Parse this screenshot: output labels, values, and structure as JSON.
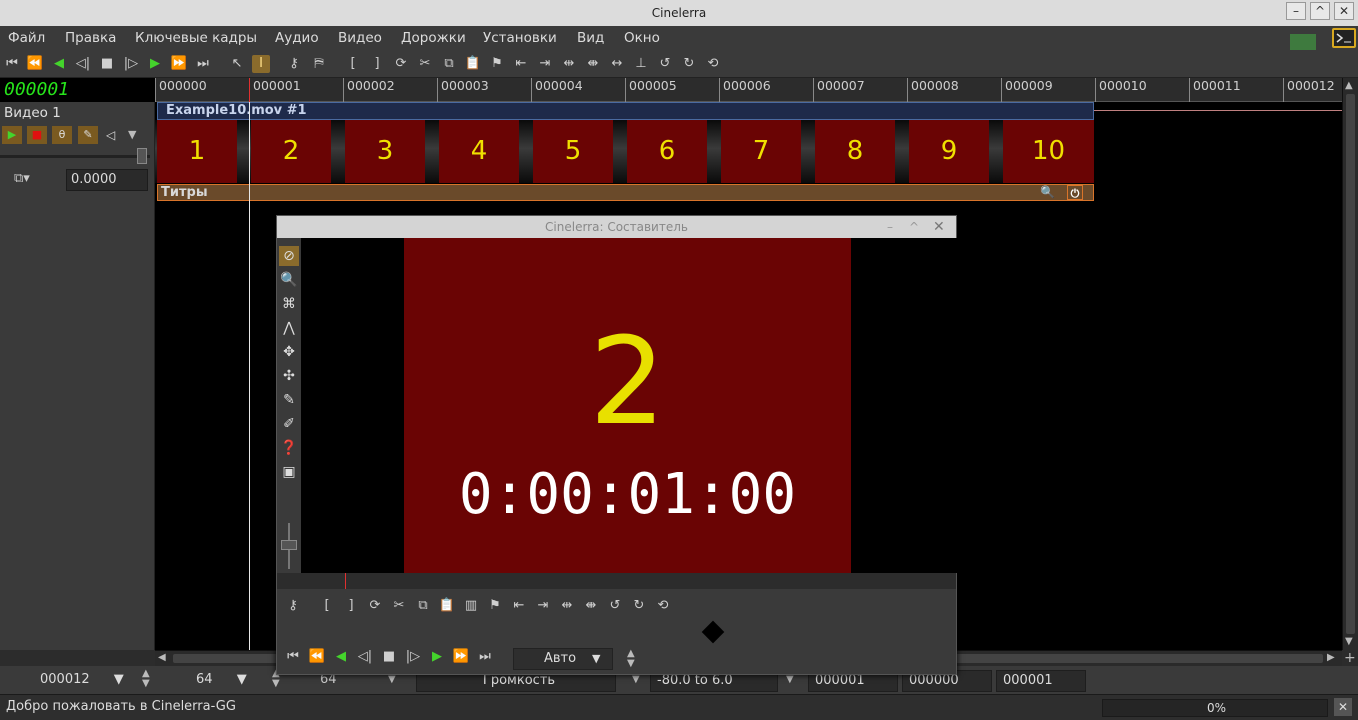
{
  "app": {
    "title": "Cinelerra"
  },
  "menu": [
    "Файл",
    "Правка",
    "Ключевые кадры",
    "Аудио",
    "Видео",
    "Дорожки",
    "Установки",
    "Вид",
    "Окно"
  ],
  "clock": "000001",
  "ruler_labels": [
    "000000",
    "000001",
    "000002",
    "000003",
    "000004",
    "000005",
    "000006",
    "000007",
    "000008",
    "000009",
    "000010",
    "000011",
    "000012"
  ],
  "track": {
    "name": "Видео 1",
    "fade_value": "0.0000",
    "clip_title": "Example10.mov #1",
    "thumbnails": [
      "1",
      "2",
      "3",
      "4",
      "5",
      "6",
      "7",
      "8",
      "9",
      "10"
    ],
    "effect_label": "Титры"
  },
  "compositor": {
    "title": "Cinelerra: Составитель",
    "frame_number": "2",
    "timecode": "0:00:01:00",
    "zoom": "Авто",
    "colors": {
      "frame_bg": "#6a0404",
      "frame_text": "#e8e000",
      "timecode_text": "#ffffff"
    }
  },
  "bottom": {
    "frames_per_sample": "000012",
    "samples_per_frame": "64",
    "curve_value": "64",
    "automation_type": "Громкость",
    "range": "-80.0 to 6.0",
    "selection_start": "000001",
    "selection_length": "000000",
    "position": "000001"
  },
  "status": {
    "message": "Добро пожаловать в Cinelerra-GG",
    "progress": "0%",
    "progress_value": 0
  },
  "theme_colors": {
    "clock_green": "#27e31b",
    "play_green": "#44d42c",
    "accent_orange": "#d9742a",
    "clip_blue": "#1e2a4a"
  }
}
